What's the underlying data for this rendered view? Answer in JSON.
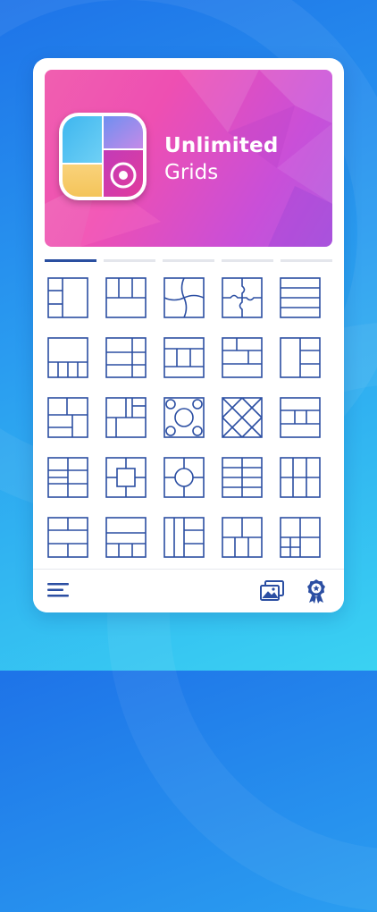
{
  "banner": {
    "title": "Unlimited",
    "subtitle": "Grids"
  },
  "tabs": {
    "count": 5,
    "active_index": 0
  },
  "icons": {
    "menu": "menu-icon",
    "gallery": "gallery-icon",
    "premium": "premium-badge-icon",
    "app_logo": "app-logo-icon"
  },
  "colors": {
    "accent": "#2a4fa0",
    "layout_stroke": "#2b4ea2",
    "banner_start": "#f05fb0",
    "banner_end": "#b25be0"
  },
  "layouts": [
    "l-split-left",
    "t-three-cols",
    "wavy-quad",
    "puzzle-quad",
    "h-rows-4",
    "top-big-bottom-4",
    "four-with-side",
    "frame-mid",
    "cross-box",
    "col-stack",
    "grid-corner",
    "stair-quad",
    "circles-ring",
    "diamond-cross",
    "rows-mid-split",
    "grid-2x3",
    "center-square",
    "center-circle",
    "grid-3x2",
    "cols-3",
    "rows-cols-mix",
    "bottom-strip",
    "col-split",
    "two-over-three",
    "corner-grid"
  ]
}
